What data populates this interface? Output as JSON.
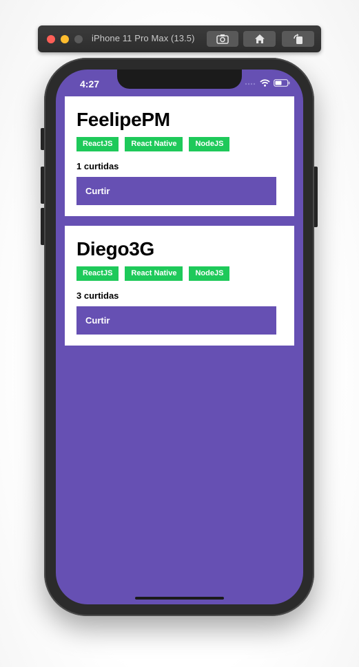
{
  "simulator": {
    "title": "iPhone 11 Pro Max (13.5)",
    "buttons": [
      {
        "icon": "screenshot-icon"
      },
      {
        "icon": "home-icon"
      },
      {
        "icon": "rotate-icon"
      }
    ]
  },
  "status_bar": {
    "time": "4:27",
    "icons": [
      "signal-icon",
      "wifi-icon",
      "battery-icon"
    ]
  },
  "colors": {
    "background": "#6650b3",
    "card": "#ffffff",
    "tech_badge": "#1ec95a",
    "button": "#6650b3"
  },
  "repositories": [
    {
      "title": "FeelipePM",
      "techs": [
        "ReactJS",
        "React Native",
        "NodeJS"
      ],
      "likes": "1 curtidas",
      "button_label": "Curtir"
    },
    {
      "title": "Diego3G",
      "techs": [
        "ReactJS",
        "React Native",
        "NodeJS"
      ],
      "likes": "3 curtidas",
      "button_label": "Curtir"
    }
  ]
}
